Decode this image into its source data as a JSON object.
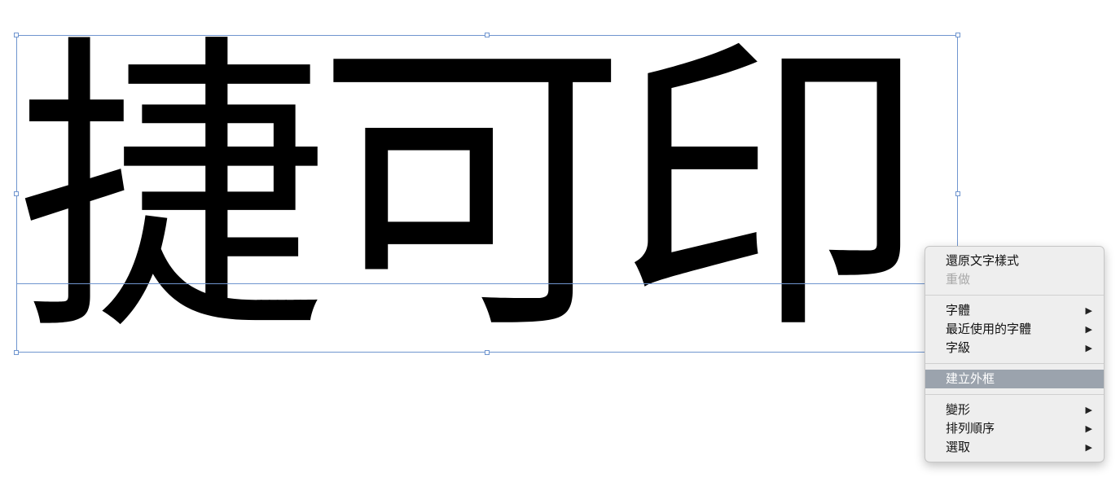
{
  "document": {
    "text": "捷可印"
  },
  "context_menu": {
    "group1": [
      {
        "label": "還原文字樣式",
        "enabled": true
      },
      {
        "label": "重做",
        "enabled": false
      }
    ],
    "group2": [
      {
        "label": "字體",
        "submenu": true,
        "arrow": "▶"
      },
      {
        "label": "最近使用的字體",
        "submenu": true,
        "arrow": "▶"
      },
      {
        "label": "字級",
        "submenu": true,
        "arrow": "▶"
      }
    ],
    "group3": [
      {
        "label": "建立外框",
        "highlighted": true
      }
    ],
    "group4": [
      {
        "label": "變形",
        "submenu": true,
        "arrow": "▶"
      },
      {
        "label": "排列順序",
        "submenu": true,
        "arrow": "▶"
      },
      {
        "label": "選取",
        "submenu": true,
        "arrow": "▶"
      }
    ]
  },
  "colors": {
    "selection": "#6f95cf",
    "menu_background": "#eeeeee",
    "menu_highlight": "#9ba3ad",
    "disabled_text": "#a8a8a8"
  }
}
